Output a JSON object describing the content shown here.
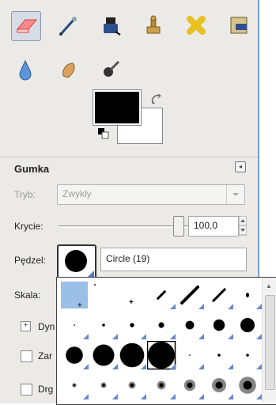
{
  "toolbox": {
    "tools": [
      {
        "icon": "eraser-icon"
      },
      {
        "icon": "airbrush-icon"
      },
      {
        "icon": "ink-icon"
      },
      {
        "icon": "clone-icon"
      },
      {
        "icon": "heal-icon"
      },
      {
        "icon": "perspective-clone-icon"
      },
      {
        "icon": "blur-icon"
      },
      {
        "icon": "smudge-icon"
      },
      {
        "icon": "dodge-burn-icon"
      }
    ],
    "foreground_color": "#000000",
    "background_color": "#ffffff"
  },
  "tool_options": {
    "title": "Gumka",
    "mode_label": "Tryb:",
    "mode_value": "Zwykły",
    "opacity_label": "Krycie:",
    "opacity_value": "100,0",
    "brush_label": "Pędzel:",
    "brush_name": "Circle (19)",
    "scale_label": "Skala:",
    "dynamics_label": "Dyn",
    "option1_label": "Zar",
    "option2_label": "Drg"
  },
  "brush_popup": {
    "brushes": [
      {
        "kind": "photo"
      },
      {
        "kind": "pixel"
      },
      {
        "kind": "cross"
      },
      {
        "kind": "stroke-small"
      },
      {
        "kind": "stroke-large"
      },
      {
        "kind": "stroke-medium"
      },
      {
        "kind": "dot-small"
      },
      {
        "kind": "dot",
        "size": 1
      },
      {
        "kind": "dot",
        "size": 2
      },
      {
        "kind": "dot",
        "size": 3
      },
      {
        "kind": "dot",
        "size": 4
      },
      {
        "kind": "dot",
        "size": 6
      },
      {
        "kind": "dot",
        "size": 8
      },
      {
        "kind": "dot",
        "size": 10
      },
      {
        "kind": "dot",
        "size": 12
      },
      {
        "kind": "dot",
        "size": 15
      },
      {
        "kind": "dot",
        "size": 17
      },
      {
        "kind": "dot",
        "size": 19,
        "selected": true
      },
      {
        "kind": "dot",
        "size": 1
      },
      {
        "kind": "dot",
        "size": 2
      },
      {
        "kind": "dot",
        "size": 2
      },
      {
        "kind": "fuzzy",
        "size": 3
      },
      {
        "kind": "fuzzy",
        "size": 4
      },
      {
        "kind": "fuzzy",
        "size": 5
      },
      {
        "kind": "fuzzy",
        "size": 6
      },
      {
        "kind": "fuzzy",
        "size": 8
      },
      {
        "kind": "fuzzy",
        "size": 10
      },
      {
        "kind": "fuzzy",
        "size": 12
      }
    ]
  }
}
